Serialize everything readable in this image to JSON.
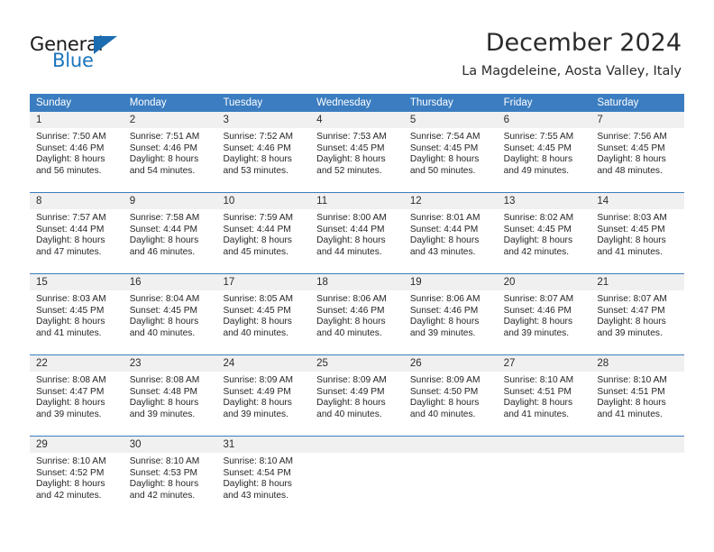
{
  "brand": {
    "name_top": "General",
    "name_bottom": "Blue",
    "triangle_color": "#1b6cb0",
    "blue_color": "#1b75bc"
  },
  "header": {
    "month_title": "December 2024",
    "location": "La Magdeleine, Aosta Valley, Italy"
  },
  "colors": {
    "header_blue": "#3b7dc0",
    "daynum_band": "#f0f0f0",
    "text": "#262626"
  },
  "calendar": {
    "weekdays": [
      "Sunday",
      "Monday",
      "Tuesday",
      "Wednesday",
      "Thursday",
      "Friday",
      "Saturday"
    ],
    "weeks": [
      [
        {
          "day": "1",
          "lines": [
            "Sunrise: 7:50 AM",
            "Sunset: 4:46 PM",
            "Daylight: 8 hours",
            "and 56 minutes."
          ]
        },
        {
          "day": "2",
          "lines": [
            "Sunrise: 7:51 AM",
            "Sunset: 4:46 PM",
            "Daylight: 8 hours",
            "and 54 minutes."
          ]
        },
        {
          "day": "3",
          "lines": [
            "Sunrise: 7:52 AM",
            "Sunset: 4:46 PM",
            "Daylight: 8 hours",
            "and 53 minutes."
          ]
        },
        {
          "day": "4",
          "lines": [
            "Sunrise: 7:53 AM",
            "Sunset: 4:45 PM",
            "Daylight: 8 hours",
            "and 52 minutes."
          ]
        },
        {
          "day": "5",
          "lines": [
            "Sunrise: 7:54 AM",
            "Sunset: 4:45 PM",
            "Daylight: 8 hours",
            "and 50 minutes."
          ]
        },
        {
          "day": "6",
          "lines": [
            "Sunrise: 7:55 AM",
            "Sunset: 4:45 PM",
            "Daylight: 8 hours",
            "and 49 minutes."
          ]
        },
        {
          "day": "7",
          "lines": [
            "Sunrise: 7:56 AM",
            "Sunset: 4:45 PM",
            "Daylight: 8 hours",
            "and 48 minutes."
          ]
        }
      ],
      [
        {
          "day": "8",
          "lines": [
            "Sunrise: 7:57 AM",
            "Sunset: 4:44 PM",
            "Daylight: 8 hours",
            "and 47 minutes."
          ]
        },
        {
          "day": "9",
          "lines": [
            "Sunrise: 7:58 AM",
            "Sunset: 4:44 PM",
            "Daylight: 8 hours",
            "and 46 minutes."
          ]
        },
        {
          "day": "10",
          "lines": [
            "Sunrise: 7:59 AM",
            "Sunset: 4:44 PM",
            "Daylight: 8 hours",
            "and 45 minutes."
          ]
        },
        {
          "day": "11",
          "lines": [
            "Sunrise: 8:00 AM",
            "Sunset: 4:44 PM",
            "Daylight: 8 hours",
            "and 44 minutes."
          ]
        },
        {
          "day": "12",
          "lines": [
            "Sunrise: 8:01 AM",
            "Sunset: 4:44 PM",
            "Daylight: 8 hours",
            "and 43 minutes."
          ]
        },
        {
          "day": "13",
          "lines": [
            "Sunrise: 8:02 AM",
            "Sunset: 4:45 PM",
            "Daylight: 8 hours",
            "and 42 minutes."
          ]
        },
        {
          "day": "14",
          "lines": [
            "Sunrise: 8:03 AM",
            "Sunset: 4:45 PM",
            "Daylight: 8 hours",
            "and 41 minutes."
          ]
        }
      ],
      [
        {
          "day": "15",
          "lines": [
            "Sunrise: 8:03 AM",
            "Sunset: 4:45 PM",
            "Daylight: 8 hours",
            "and 41 minutes."
          ]
        },
        {
          "day": "16",
          "lines": [
            "Sunrise: 8:04 AM",
            "Sunset: 4:45 PM",
            "Daylight: 8 hours",
            "and 40 minutes."
          ]
        },
        {
          "day": "17",
          "lines": [
            "Sunrise: 8:05 AM",
            "Sunset: 4:45 PM",
            "Daylight: 8 hours",
            "and 40 minutes."
          ]
        },
        {
          "day": "18",
          "lines": [
            "Sunrise: 8:06 AM",
            "Sunset: 4:46 PM",
            "Daylight: 8 hours",
            "and 40 minutes."
          ]
        },
        {
          "day": "19",
          "lines": [
            "Sunrise: 8:06 AM",
            "Sunset: 4:46 PM",
            "Daylight: 8 hours",
            "and 39 minutes."
          ]
        },
        {
          "day": "20",
          "lines": [
            "Sunrise: 8:07 AM",
            "Sunset: 4:46 PM",
            "Daylight: 8 hours",
            "and 39 minutes."
          ]
        },
        {
          "day": "21",
          "lines": [
            "Sunrise: 8:07 AM",
            "Sunset: 4:47 PM",
            "Daylight: 8 hours",
            "and 39 minutes."
          ]
        }
      ],
      [
        {
          "day": "22",
          "lines": [
            "Sunrise: 8:08 AM",
            "Sunset: 4:47 PM",
            "Daylight: 8 hours",
            "and 39 minutes."
          ]
        },
        {
          "day": "23",
          "lines": [
            "Sunrise: 8:08 AM",
            "Sunset: 4:48 PM",
            "Daylight: 8 hours",
            "and 39 minutes."
          ]
        },
        {
          "day": "24",
          "lines": [
            "Sunrise: 8:09 AM",
            "Sunset: 4:49 PM",
            "Daylight: 8 hours",
            "and 39 minutes."
          ]
        },
        {
          "day": "25",
          "lines": [
            "Sunrise: 8:09 AM",
            "Sunset: 4:49 PM",
            "Daylight: 8 hours",
            "and 40 minutes."
          ]
        },
        {
          "day": "26",
          "lines": [
            "Sunrise: 8:09 AM",
            "Sunset: 4:50 PM",
            "Daylight: 8 hours",
            "and 40 minutes."
          ]
        },
        {
          "day": "27",
          "lines": [
            "Sunrise: 8:10 AM",
            "Sunset: 4:51 PM",
            "Daylight: 8 hours",
            "and 41 minutes."
          ]
        },
        {
          "day": "28",
          "lines": [
            "Sunrise: 8:10 AM",
            "Sunset: 4:51 PM",
            "Daylight: 8 hours",
            "and 41 minutes."
          ]
        }
      ],
      [
        {
          "day": "29",
          "lines": [
            "Sunrise: 8:10 AM",
            "Sunset: 4:52 PM",
            "Daylight: 8 hours",
            "and 42 minutes."
          ]
        },
        {
          "day": "30",
          "lines": [
            "Sunrise: 8:10 AM",
            "Sunset: 4:53 PM",
            "Daylight: 8 hours",
            "and 42 minutes."
          ]
        },
        {
          "day": "31",
          "lines": [
            "Sunrise: 8:10 AM",
            "Sunset: 4:54 PM",
            "Daylight: 8 hours",
            "and 43 minutes."
          ]
        },
        {
          "day": "",
          "lines": []
        },
        {
          "day": "",
          "lines": []
        },
        {
          "day": "",
          "lines": []
        },
        {
          "day": "",
          "lines": []
        }
      ]
    ]
  }
}
